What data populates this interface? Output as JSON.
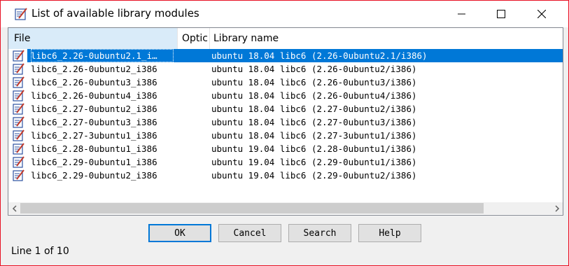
{
  "window": {
    "title": "List of available library modules",
    "icon": "library-module-icon"
  },
  "columns": {
    "file": "File",
    "options": "Optic",
    "library_name": "Library name"
  },
  "rows": [
    {
      "file": "libc6_2.26-0ubuntu2.1_i…",
      "library": "ubuntu 18.04 libc6 (2.26-0ubuntu2.1/i386)",
      "selected": true
    },
    {
      "file": "libc6_2.26-0ubuntu2_i386",
      "library": "ubuntu 18.04 libc6 (2.26-0ubuntu2/i386)"
    },
    {
      "file": "libc6_2.26-0ubuntu3_i386",
      "library": "ubuntu 18.04 libc6 (2.26-0ubuntu3/i386)"
    },
    {
      "file": "libc6_2.26-0ubuntu4_i386",
      "library": "ubuntu 18.04 libc6 (2.26-0ubuntu4/i386)"
    },
    {
      "file": "libc6_2.27-0ubuntu2_i386",
      "library": "ubuntu 18.04 libc6 (2.27-0ubuntu2/i386)"
    },
    {
      "file": "libc6_2.27-0ubuntu3_i386",
      "library": "ubuntu 18.04 libc6 (2.27-0ubuntu3/i386)"
    },
    {
      "file": "libc6_2.27-3ubuntu1_i386",
      "library": "ubuntu 18.04 libc6 (2.27-3ubuntu1/i386)"
    },
    {
      "file": "libc6_2.28-0ubuntu1_i386",
      "library": "ubuntu 19.04 libc6 (2.28-0ubuntu1/i386)"
    },
    {
      "file": "libc6_2.29-0ubuntu1_i386",
      "library": "ubuntu 19.04 libc6 (2.29-0ubuntu1/i386)"
    },
    {
      "file": "libc6_2.29-0ubuntu2_i386",
      "library": "ubuntu 19.04 libc6 (2.29-0ubuntu2/i386)"
    }
  ],
  "buttons": {
    "ok": "OK",
    "cancel": "Cancel",
    "search": "Search",
    "help": "Help"
  },
  "status": "Line 1 of 10",
  "colors": {
    "selection": "#0078d7",
    "window_border": "#e81123"
  }
}
